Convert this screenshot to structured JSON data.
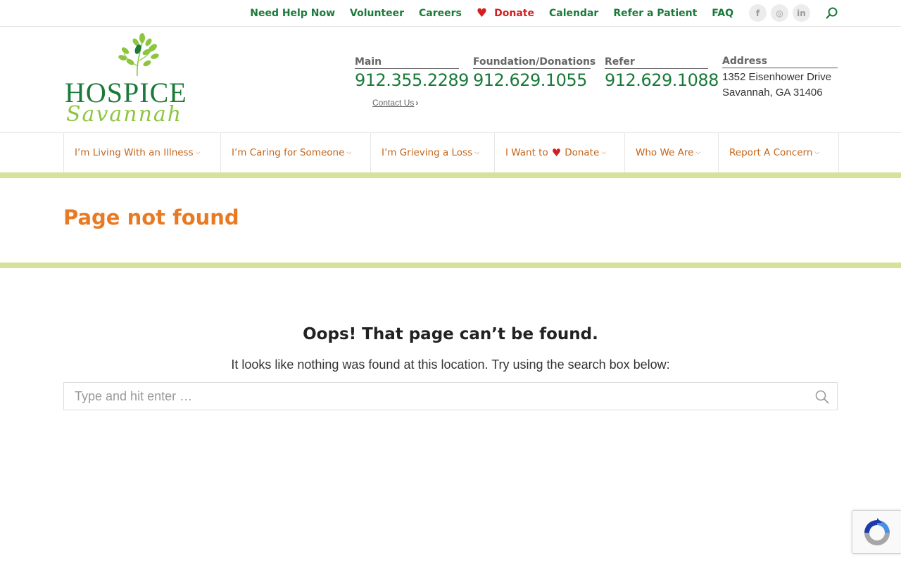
{
  "colors": {
    "brand_green": "#1b7a3a",
    "accent_orange": "#ea7a22",
    "nav_orange": "#c4651a",
    "heart_red": "#d31f1f",
    "bar_green": "#d5e39a"
  },
  "topbar": {
    "links": [
      {
        "label": "Need Help Now"
      },
      {
        "label": "Volunteer"
      },
      {
        "label": "Careers"
      },
      {
        "label": "Donate",
        "icon": "heart-icon"
      },
      {
        "label": "Calendar"
      },
      {
        "label": "Refer a Patient"
      },
      {
        "label": "FAQ"
      }
    ],
    "social": [
      {
        "icon": "facebook-icon",
        "glyph": "f"
      },
      {
        "icon": "instagram-icon",
        "glyph": "◎"
      },
      {
        "icon": "linkedin-icon",
        "glyph": "in"
      }
    ],
    "search_icon": "search-icon"
  },
  "logo": {
    "line1": "HOSPICE",
    "line2": "Savannah"
  },
  "contacts": [
    {
      "label": "Main",
      "phone": "912.355.2289"
    },
    {
      "label": "Foundation/Donations",
      "phone": "912.629.1055"
    },
    {
      "label": "Refer",
      "phone": "912.629.1088"
    }
  ],
  "contact_link": "Contact Us",
  "address": {
    "label": "Address",
    "line1": "1352 Eisenhower Drive",
    "line2": "Savannah, GA 31406"
  },
  "nav": {
    "items": [
      {
        "label": "I’m Living With an Illness"
      },
      {
        "label": "I’m Caring for Someone"
      },
      {
        "label": "I’m Grieving a Loss"
      },
      {
        "label_pre": "I Want to",
        "label_post": "Donate"
      },
      {
        "label": "Who We Are"
      },
      {
        "label": "Report A Concern"
      }
    ]
  },
  "page_title": "Page not found",
  "content": {
    "heading": "Oops! That page can’t be found.",
    "description": "It looks like nothing was found at this location. Try using the search box below:",
    "search_placeholder": "Type and hit enter …"
  }
}
